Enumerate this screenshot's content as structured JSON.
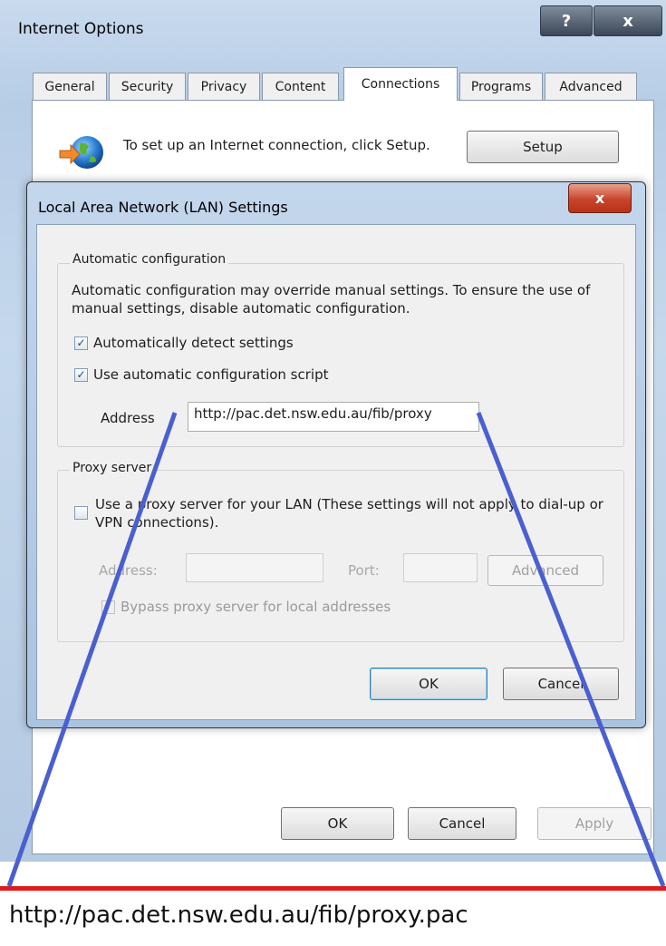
{
  "outer": {
    "title": "Internet Options",
    "help_label": "?",
    "close_label": "x",
    "tabs": [
      "General",
      "Security",
      "Privacy",
      "Content",
      "Connections",
      "Programs",
      "Advanced"
    ],
    "active_tab": "Connections",
    "setup_text": "To set up an Internet connection, click Setup.",
    "setup_button": "Setup",
    "ok_button": "OK",
    "cancel_button": "Cancel",
    "apply_button": "Apply"
  },
  "lan": {
    "title": "Local Area Network (LAN) Settings",
    "close_label": "x",
    "auto_config": {
      "legend": "Automatic configuration",
      "description": "Automatic configuration may override manual settings.  To ensure the use of manual settings, disable automatic configuration.",
      "detect_label": "Automatically detect settings",
      "detect_checked": true,
      "script_label": "Use automatic configuration script",
      "script_checked": true,
      "address_label": "Address",
      "address_value": "http://pac.det.nsw.edu.au/fib/proxy"
    },
    "proxy": {
      "legend": "Proxy server",
      "use_proxy_label": "Use a proxy server for your LAN (These settings will not apply to dial-up or VPN connections).",
      "use_proxy_checked": false,
      "address_label": "Address:",
      "port_label": "Port:",
      "advanced_button": "Advanced",
      "bypass_label": "Bypass proxy server for local addresses"
    },
    "ok_button": "OK",
    "cancel_button": "Cancel"
  },
  "callout": {
    "url": "http://pac.det.nsw.edu.au/fib/proxy.pac",
    "line_color": "#4a5fd0",
    "border_color": "#e01b1b"
  }
}
